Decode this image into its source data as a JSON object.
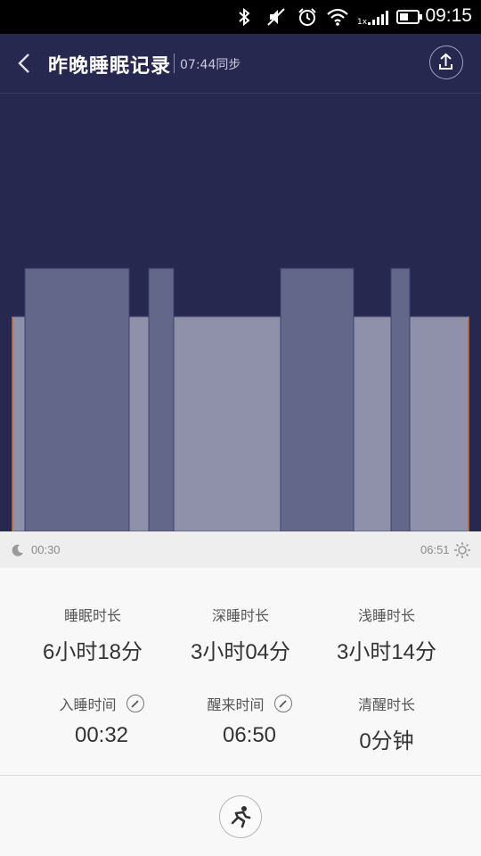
{
  "status_bar": {
    "time": "09:15",
    "network_label": "1x",
    "icons": [
      "bluetooth-icon",
      "mute-icon",
      "alarm-icon",
      "wifi-icon",
      "signal-icon",
      "battery-icon"
    ]
  },
  "header": {
    "title": "昨晚睡眠记录",
    "sync_text": "07:44同步",
    "icons": [
      "back-icon",
      "upload-icon"
    ]
  },
  "chart_data": {
    "type": "bar",
    "start_label": "00:30",
    "end_label": "06:51",
    "levels": {
      "deep": 2,
      "light": 1
    },
    "stages": [
      {
        "stage": "light",
        "level": 1
      },
      {
        "stage": "deep",
        "level": 2
      },
      {
        "stage": "light",
        "level": 1
      },
      {
        "stage": "deep",
        "level": 2
      },
      {
        "stage": "light",
        "level": 1
      },
      {
        "stage": "deep",
        "level": 2
      },
      {
        "stage": "light",
        "level": 1
      },
      {
        "stage": "deep",
        "level": 2
      },
      {
        "stage": "light",
        "level": 1
      }
    ],
    "colors": {
      "deep": "#63688a",
      "light": "#8f91aa",
      "background": "#26284f",
      "edge": "#c0703a"
    }
  },
  "stats": {
    "total_label": "睡眠时长",
    "total_value": "6小时18分",
    "deep_label": "深睡时长",
    "deep_value": "3小时04分",
    "light_label": "浅睡时长",
    "light_value": "3小时14分",
    "sleep_label": "入睡时间",
    "sleep_value": "00:32",
    "wake_label": "醒来时间",
    "wake_value": "06:50",
    "awake_label": "清醒时长",
    "awake_value": "0分钟"
  }
}
